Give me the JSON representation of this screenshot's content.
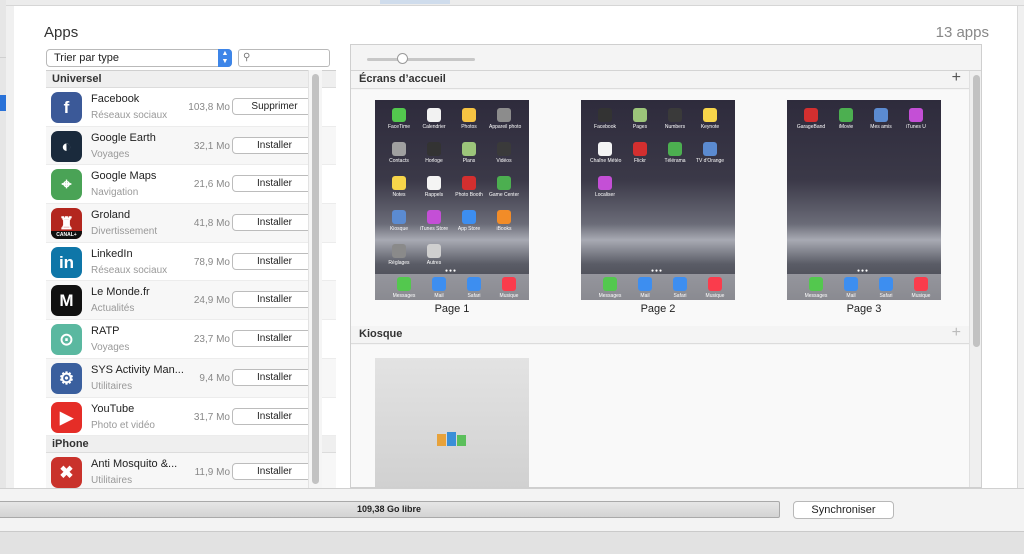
{
  "header": {
    "title": "Apps",
    "count": "13 apps"
  },
  "controls": {
    "sort_label": "Trier par type",
    "search_placeholder": ""
  },
  "groups": [
    {
      "title": "Universel"
    },
    {
      "title": "iPhone"
    }
  ],
  "apps": [
    {
      "name": "Facebook",
      "category": "Réseaux sociaux",
      "size": "103,8 Mo",
      "action": "Supprimer",
      "icon": "facebook-icon",
      "color": "#3b5998"
    },
    {
      "name": "Google Earth",
      "category": "Voyages",
      "size": "32,1 Mo",
      "action": "Installer",
      "icon": "google-earth-icon",
      "color": "#1a2a3c"
    },
    {
      "name": "Google Maps",
      "category": "Navigation",
      "size": "21,6 Mo",
      "action": "Installer",
      "icon": "google-maps-icon",
      "color": "#4aa356"
    },
    {
      "name": "Groland",
      "category": "Divertissement",
      "size": "41,8 Mo",
      "action": "Installer",
      "icon": "groland-icon",
      "color": "#b3261e",
      "badge": "CANAL+"
    },
    {
      "name": "LinkedIn",
      "category": "Réseaux sociaux",
      "size": "78,9 Mo",
      "action": "Installer",
      "icon": "linkedin-icon",
      "color": "#0e76a8"
    },
    {
      "name": "Le Monde.fr",
      "category": "Actualités",
      "size": "24,9 Mo",
      "action": "Installer",
      "icon": "le-monde-icon",
      "color": "#111111"
    },
    {
      "name": "RATP",
      "category": "Voyages",
      "size": "23,7 Mo",
      "action": "Installer",
      "icon": "ratp-icon",
      "color": "#5ab8a0"
    },
    {
      "name": "SYS Activity Man...",
      "category": "Utilitaires",
      "size": "9,4 Mo",
      "action": "Installer",
      "icon": "sys-activity-icon",
      "color": "#3a5f9e"
    },
    {
      "name": "YouTube",
      "category": "Photo et vidéo",
      "size": "31,7 Mo",
      "action": "Installer",
      "icon": "youtube-icon",
      "color": "#e52d27"
    },
    {
      "name": "Anti Mosquito &...",
      "category": "Utilitaires",
      "size": "11,9 Mo",
      "action": "Installer",
      "icon": "anti-mosquito-icon",
      "color": "#c9322b"
    }
  ],
  "panel": {
    "home_title": "Écrans d’accueil",
    "kiosk_title": "Kiosque",
    "pages": [
      {
        "label": "Page 1",
        "apps": [
          "FaceTime",
          "Calendrier",
          "Photos",
          "Appareil photo",
          "Contacts",
          "Horloge",
          "Plans",
          "Vidéos",
          "Notes",
          "Rappels",
          "Photo Booth",
          "Game Center",
          "Kiosque",
          "iTunes Store",
          "App Store",
          "iBooks",
          "Réglages",
          "Autres"
        ]
      },
      {
        "label": "Page 2",
        "apps": [
          "Facebook",
          "Pages",
          "Numbers",
          "Keynote",
          "Chaîne Météo",
          "Flickr",
          "Télérama",
          "TV d'Orange",
          "Localiser"
        ]
      },
      {
        "label": "Page 3",
        "apps": [
          "GarageBand",
          "iMovie",
          "Mes amis",
          "iTunes U"
        ]
      }
    ],
    "dock": [
      "Messages",
      "Mail",
      "Safari",
      "Musique"
    ]
  },
  "storage": {
    "free": "109,38 Go libre"
  },
  "sync": {
    "label": "Synchroniser"
  }
}
